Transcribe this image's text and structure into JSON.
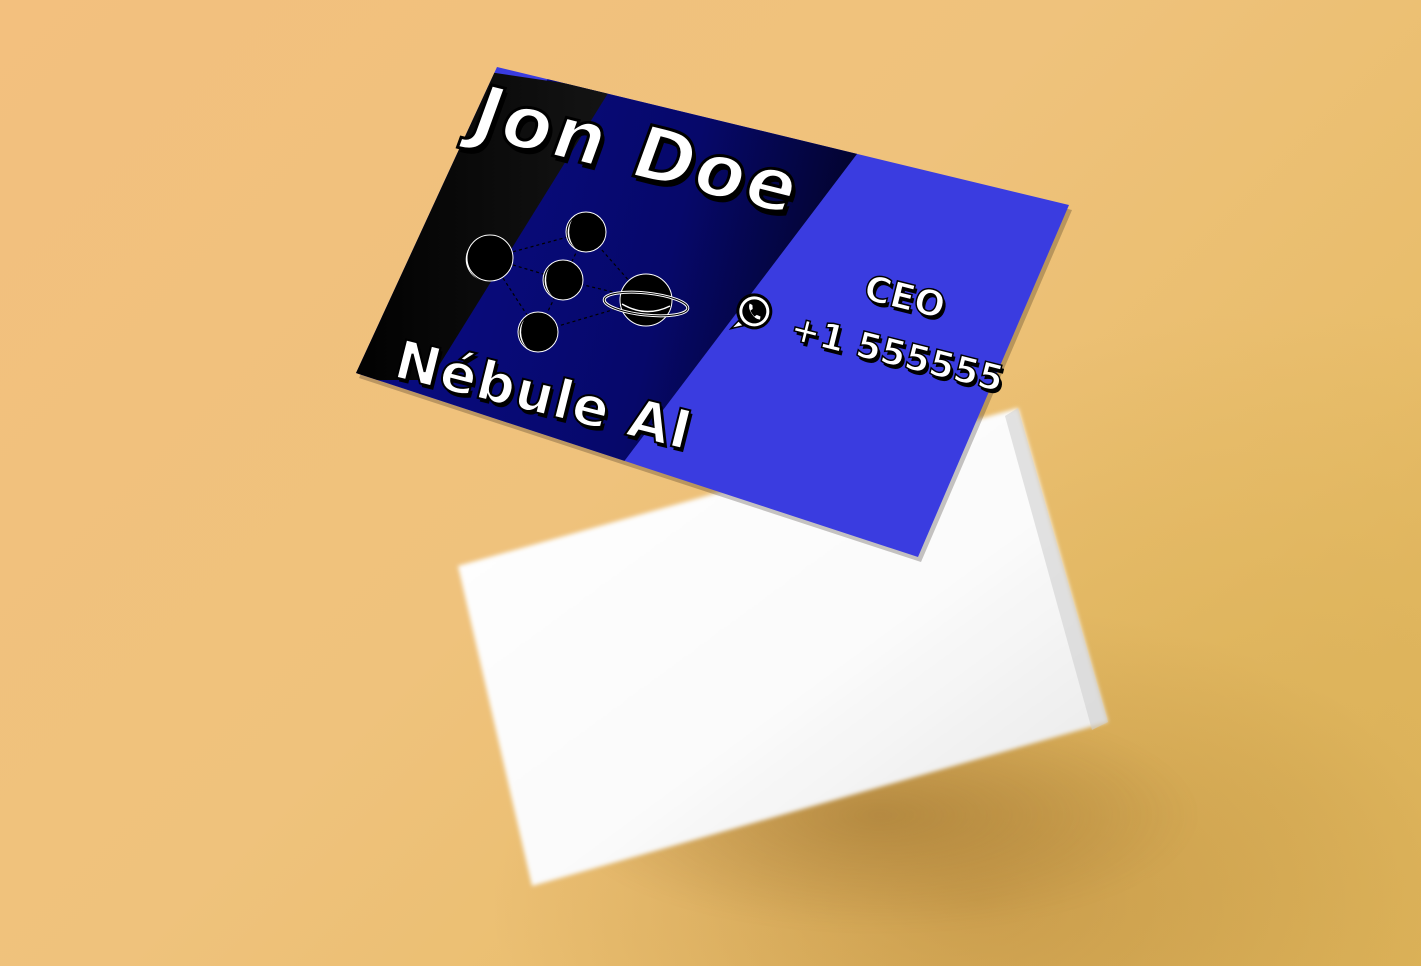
{
  "card": {
    "name": "Jon Doe",
    "company": "Nébule AI",
    "role": "CEO",
    "phone": "+1 555555"
  },
  "icons": {
    "contact_icon": "whatsapp-icon",
    "logo_icon": "planet-network-logo-icon"
  },
  "colors": {
    "background": "#efc27c",
    "card_black": "#000000",
    "card_navy": "#0a0e7a",
    "card_blue": "#3a3ce0",
    "card_back": "#ffffff",
    "text": "#ffffff"
  }
}
